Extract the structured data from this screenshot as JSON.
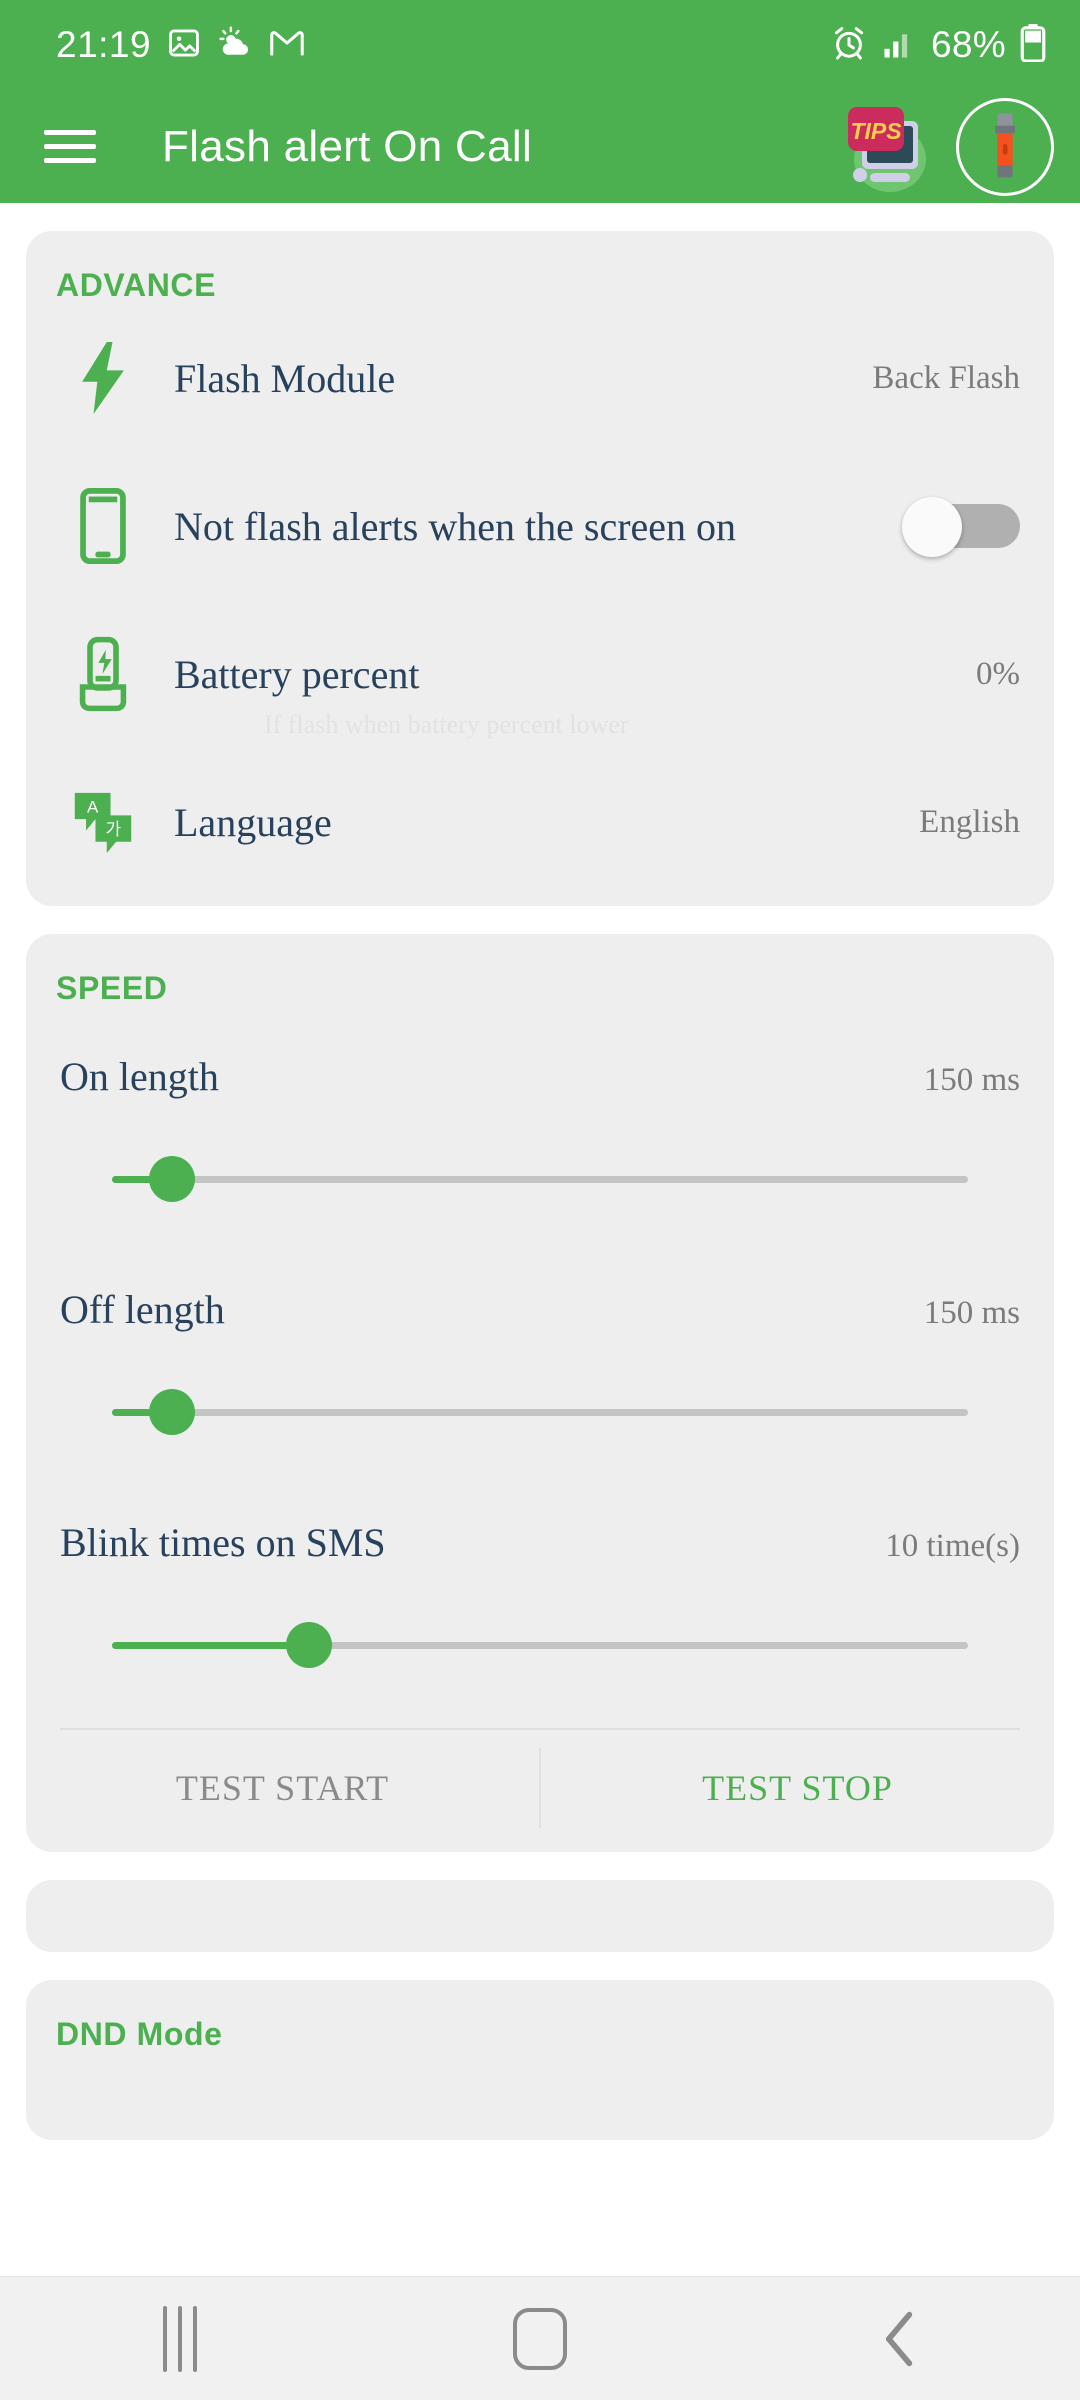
{
  "status_bar": {
    "time": "21:19",
    "left_icons": [
      "image-icon",
      "weather-icon",
      "gmail-icon"
    ],
    "right_icons": [
      "alarm-icon",
      "signal-icon"
    ],
    "battery_percent": "68%",
    "battery_icon": "battery-icon"
  },
  "app_bar": {
    "menu_icon": "hamburger-menu-icon",
    "title": "Flash alert On Call",
    "tips_icon": "tips-icon",
    "tips_label": "TIPS",
    "flashlight_icon": "flashlight-icon"
  },
  "advance": {
    "header": "ADVANCE",
    "rows": [
      {
        "icon": "lightning-bolt-icon",
        "label": "Flash Module",
        "value": "Back Flash"
      },
      {
        "icon": "phone-screen-icon",
        "label": "Not flash alerts when the screen on",
        "toggle": "off"
      },
      {
        "icon": "battery-charge-icon",
        "label": "Battery percent",
        "value": "0%",
        "sub": "If flash when battery percent lower"
      },
      {
        "icon": "translate-icon",
        "label": "Language",
        "value": "English"
      }
    ]
  },
  "speed": {
    "header": "SPEED",
    "sliders": [
      {
        "label": "On length",
        "value": "150 ms",
        "percent": 7
      },
      {
        "label": "Off length",
        "value": "150 ms",
        "percent": 7
      },
      {
        "label": "Blink times on SMS",
        "value": "10 time(s)",
        "percent": 23
      }
    ],
    "test_start": "TEST START",
    "test_stop": "TEST STOP"
  },
  "dnd": {
    "header": "DND Mode"
  },
  "nav_bar": {
    "recents_icon": "recents-icon",
    "home_icon": "home-icon",
    "back_icon": "back-icon"
  },
  "colors": {
    "brand_green": "#4caf50",
    "card_bg": "#eeeeee",
    "label_navy": "#28415c",
    "value_gray": "#7b7b7b"
  }
}
